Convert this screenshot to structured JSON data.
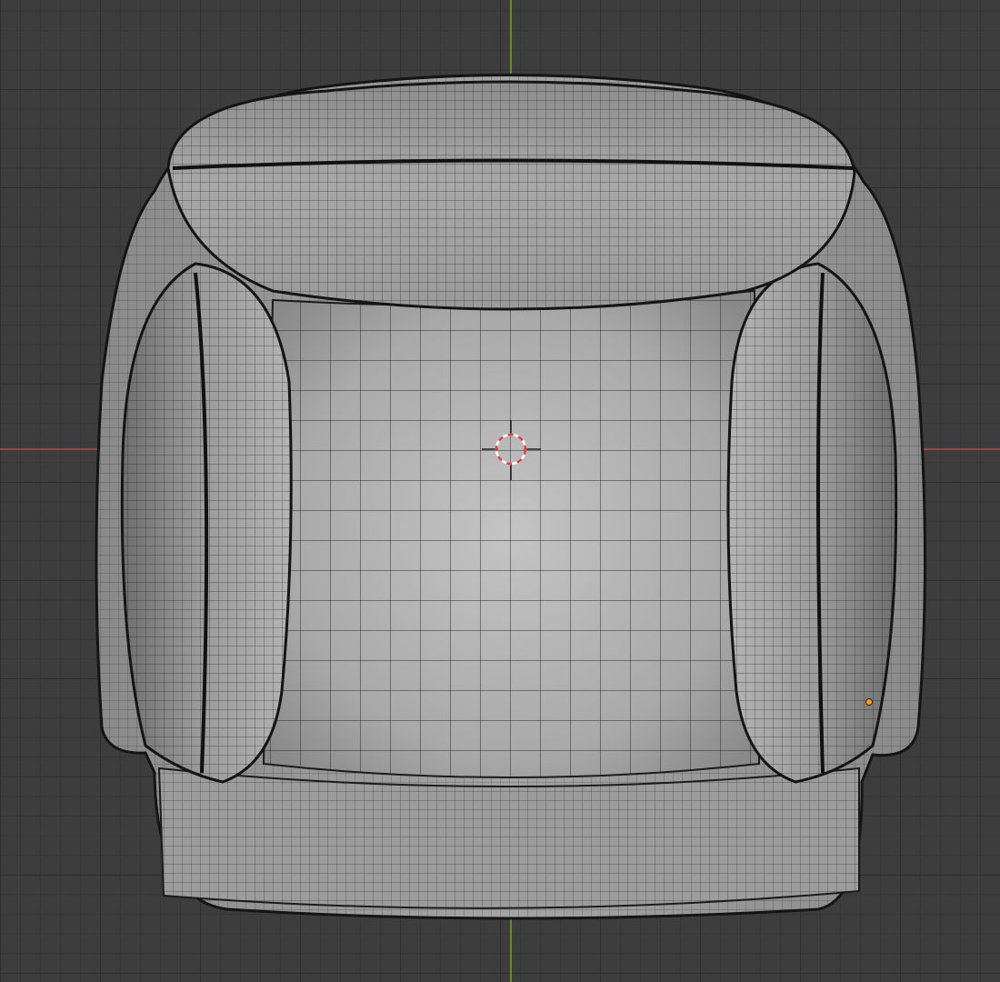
{
  "viewport": {
    "mode": "top-orthographic",
    "background_color": "#3d3d3d",
    "grid_color": "#2f2f2f",
    "x_axis_color": "#b04a4a",
    "y_axis_color": "#7aa22c"
  },
  "object": {
    "kind": "armchair-mesh",
    "shading": "solid-with-wireframe",
    "parts": [
      "backrest-cushion",
      "left-armrest-cushion",
      "right-armrest-cushion",
      "seat-cushion",
      "outer-frame"
    ],
    "surface_color": "#a8a8a8",
    "wire_color": "#1a1a1a"
  },
  "cursor_3d": {
    "icon": "crosshair-ring-icon",
    "ring_color": "#e04040"
  },
  "origin_point": {
    "icon": "dot-icon",
    "color": "#f0a030"
  }
}
